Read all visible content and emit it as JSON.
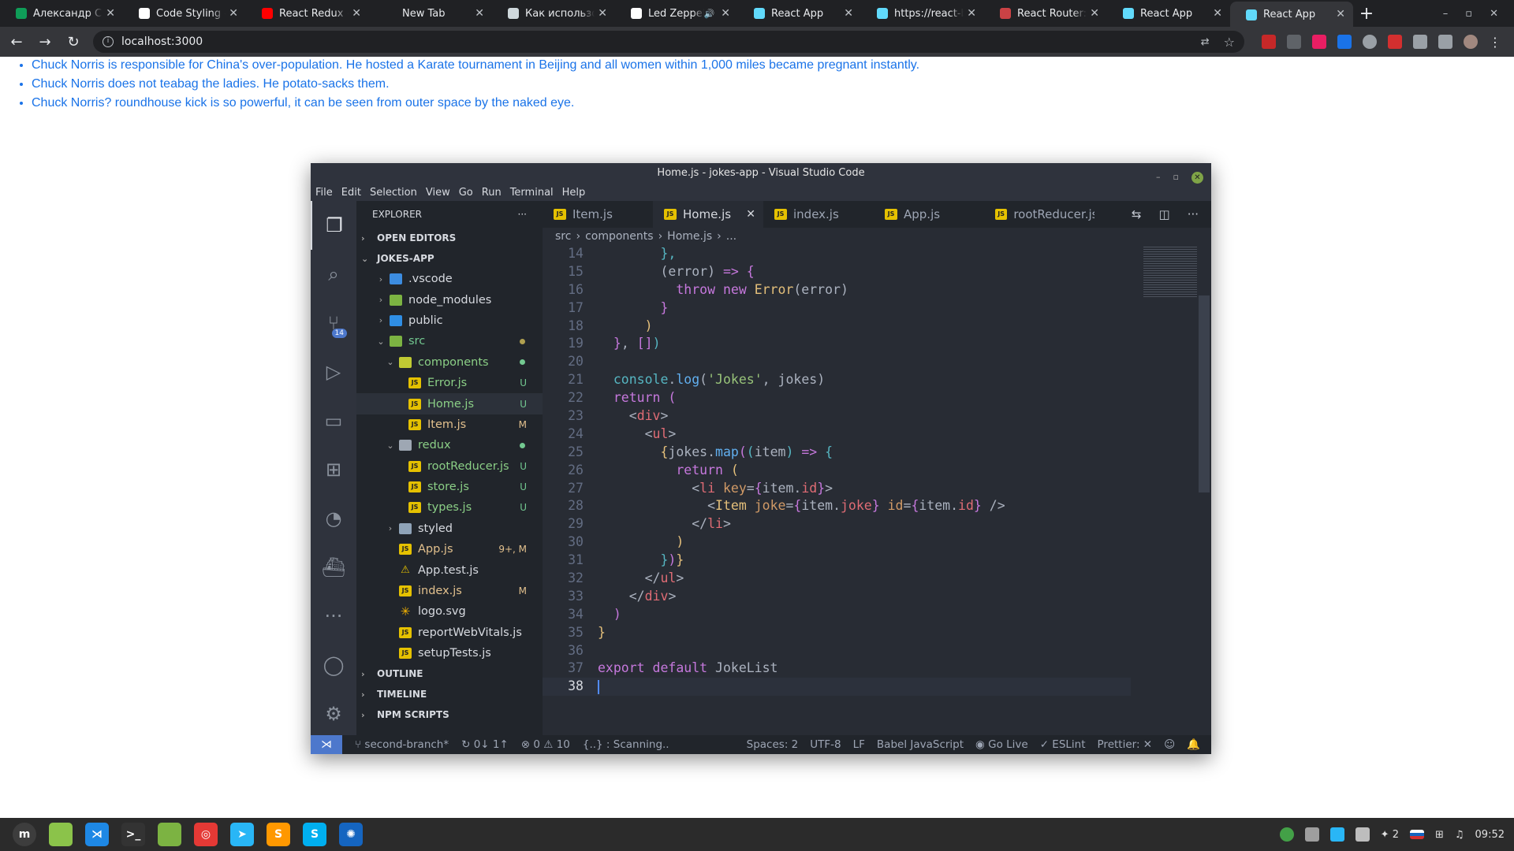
{
  "browser": {
    "tabs": [
      {
        "title": "Александр Cap",
        "color": "#0f9d58",
        "active": false
      },
      {
        "title": "Code Styling - E",
        "color": "#ffffff",
        "active": false
      },
      {
        "title": "React Redux + S",
        "color": "#ff0000",
        "active": false
      },
      {
        "title": "New Tab",
        "color": "",
        "active": false
      },
      {
        "title": "Как использов",
        "color": "#cfd8dc",
        "active": false
      },
      {
        "title": "Led Zeppeli",
        "color": "#ffffff",
        "active": false,
        "audio": "🔊"
      },
      {
        "title": "React App",
        "color": "#61dafb",
        "active": false
      },
      {
        "title": "https://react-b",
        "color": "#61dafb",
        "active": false
      },
      {
        "title": "React Router: D",
        "color": "#ca4245",
        "active": false
      },
      {
        "title": "React App",
        "color": "#61dafb",
        "active": false
      },
      {
        "title": "React App",
        "color": "#61dafb",
        "active": true
      }
    ],
    "url": "localhost:3000"
  },
  "page": {
    "jokes": [
      "Chuck Norris is responsible for China's over-population. He hosted a Karate tournament in Beijing and all women within 1,000 miles became pregnant instantly.",
      "Chuck Norris does not teabag the ladies. He potato-sacks them.",
      "Chuck Norris? roundhouse kick is so powerful, it can be seen from outer space by the naked eye."
    ]
  },
  "vscode": {
    "title": "Home.js - jokes-app - Visual Studio Code",
    "menu": [
      "File",
      "Edit",
      "Selection",
      "View",
      "Go",
      "Run",
      "Terminal",
      "Help"
    ],
    "explorer_title": "EXPLORER",
    "open_editors": "OPEN EDITORS",
    "project": "JOKES-APP",
    "scm_badge": "14",
    "tree": [
      {
        "name": ".vscode",
        "depth": 1,
        "icon": "fi-vscode",
        "chev": "›",
        "label": "lbl-default",
        "status": ""
      },
      {
        "name": "node_modules",
        "depth": 1,
        "icon": "fi-node",
        "chev": "›",
        "label": "lbl-default",
        "status": ""
      },
      {
        "name": "public",
        "depth": 1,
        "icon": "fi-public",
        "chev": "›",
        "label": "lbl-default",
        "status": ""
      },
      {
        "name": "src",
        "depth": 1,
        "icon": "fi-src",
        "chev": "⌄",
        "label": "lbl-src",
        "status": "",
        "dot": "dot"
      },
      {
        "name": "components",
        "depth": 2,
        "icon": "fi-comp",
        "chev": "⌄",
        "label": "lbl-U",
        "status": "",
        "dot": "dot green"
      },
      {
        "name": "Error.js",
        "depth": 3,
        "icon": "fi-js",
        "chev": "",
        "label": "lbl-U",
        "status": "U"
      },
      {
        "name": "Home.js",
        "depth": 3,
        "icon": "fi-js",
        "chev": "",
        "label": "lbl-U",
        "status": "U",
        "selected": true
      },
      {
        "name": "Item.js",
        "depth": 3,
        "icon": "fi-js",
        "chev": "",
        "label": "lbl-M",
        "status": "M"
      },
      {
        "name": "redux",
        "depth": 2,
        "icon": "fi-redux",
        "chev": "⌄",
        "label": "lbl-U",
        "status": "",
        "dot": "dot green"
      },
      {
        "name": "rootReducer.js",
        "depth": 3,
        "icon": "fi-js",
        "chev": "",
        "label": "lbl-U",
        "status": "U"
      },
      {
        "name": "store.js",
        "depth": 3,
        "icon": "fi-js",
        "chev": "",
        "label": "lbl-U",
        "status": "U"
      },
      {
        "name": "types.js",
        "depth": 3,
        "icon": "fi-js",
        "chev": "",
        "label": "lbl-U",
        "status": "U"
      },
      {
        "name": "styled",
        "depth": 2,
        "icon": "fi-folder",
        "chev": "›",
        "label": "lbl-default",
        "status": ""
      },
      {
        "name": "App.js",
        "depth": 2,
        "icon": "fi-js",
        "chev": "",
        "label": "lbl-M",
        "status": "9+, M"
      },
      {
        "name": "App.test.js",
        "depth": 2,
        "icon": "fi-test",
        "chev": "",
        "label": "lbl-default",
        "status": ""
      },
      {
        "name": "index.js",
        "depth": 2,
        "icon": "fi-js",
        "chev": "",
        "label": "lbl-M",
        "status": "M"
      },
      {
        "name": "logo.svg",
        "depth": 2,
        "icon": "fi-svg",
        "chev": "",
        "label": "lbl-default",
        "status": ""
      },
      {
        "name": "reportWebVitals.js",
        "depth": 2,
        "icon": "fi-js",
        "chev": "",
        "label": "lbl-default",
        "status": ""
      },
      {
        "name": "setupTests.js",
        "depth": 2,
        "icon": "fi-js",
        "chev": "",
        "label": "lbl-default",
        "status": ""
      }
    ],
    "bottom_sections": [
      "OUTLINE",
      "TIMELINE",
      "NPM SCRIPTS"
    ],
    "editor_tabs": [
      {
        "name": "Item.js",
        "active": false
      },
      {
        "name": "Home.js",
        "active": true
      },
      {
        "name": "index.js",
        "active": false
      },
      {
        "name": "App.js",
        "active": false
      },
      {
        "name": "rootReducer.js",
        "active": false
      }
    ],
    "breadcrumbs": [
      "src",
      "components",
      "Home.js",
      "..."
    ],
    "code": [
      {
        "n": "14",
        "html": "<span class=\"pl\">        </span><span class=\"b3\">},</span>"
      },
      {
        "n": "15",
        "html": "<span class=\"pl\">        (</span><span class=\"pl\">error</span><span class=\"pl\">) </span><span class=\"kw\">=&gt;</span><span class=\"pl\"> </span><span class=\"b2\">{</span>"
      },
      {
        "n": "16",
        "html": "<span class=\"pl\">          </span><span class=\"kw\">throw new</span><span class=\"pl\"> </span><span class=\"cls\">Error</span><span class=\"pl\">(error)</span>"
      },
      {
        "n": "17",
        "html": "<span class=\"pl\">        </span><span class=\"b2\">}</span>"
      },
      {
        "n": "18",
        "html": "<span class=\"pl\">      </span><span class=\"b1\">)</span>"
      },
      {
        "n": "19",
        "html": "<span class=\"pl\">  </span><span class=\"b2\">}</span><span class=\"pl\">, </span><span class=\"b2\">[]</span><span class=\"b3\">)</span>"
      },
      {
        "n": "20",
        "html": ""
      },
      {
        "n": "21",
        "html": "<span class=\"pl\">  </span><span class=\"cy\">console</span><span class=\"pl\">.</span><span class=\"fn\">log</span><span class=\"pl\">(</span><span class=\"st\">'Jokes'</span><span class=\"pl\">, jokes)</span>"
      },
      {
        "n": "22",
        "html": "<span class=\"pl\">  </span><span class=\"kw\">return</span><span class=\"pl\"> </span><span class=\"b2\">(</span>"
      },
      {
        "n": "23",
        "html": "<span class=\"pl\">    </span><span class=\"pl\">&lt;</span><span class=\"tg\">div</span><span class=\"pl\">&gt;</span>"
      },
      {
        "n": "24",
        "html": "<span class=\"pl\">      </span><span class=\"pl\">&lt;</span><span class=\"tg\">ul</span><span class=\"pl\">&gt;</span>"
      },
      {
        "n": "25",
        "html": "<span class=\"pl\">        </span><span class=\"b1\">{</span><span class=\"pl\">jokes.</span><span class=\"fn\">map</span><span class=\"b2\">(</span><span class=\"b3\">(</span><span class=\"pl\">item</span><span class=\"b3\">)</span><span class=\"pl\"> </span><span class=\"kw\">=&gt;</span><span class=\"pl\"> </span><span class=\"b3\">{</span>"
      },
      {
        "n": "26",
        "html": "<span class=\"pl\">          </span><span class=\"kw\">return</span><span class=\"pl\"> </span><span class=\"b1\">(</span>"
      },
      {
        "n": "27",
        "html": "<span class=\"pl\">            </span><span class=\"pl\">&lt;</span><span class=\"tg\">li</span><span class=\"pl\"> </span><span class=\"at\">key</span><span class=\"pl\">=</span><span class=\"b2\">{</span><span class=\"pl\">item.</span><span class=\"tg\">id</span><span class=\"b2\">}</span><span class=\"pl\">&gt;</span>"
      },
      {
        "n": "28",
        "html": "<span class=\"pl\">              </span><span class=\"pl\">&lt;</span><span class=\"cls\">Item</span><span class=\"pl\"> </span><span class=\"at\">joke</span><span class=\"pl\">=</span><span class=\"b2\">{</span><span class=\"pl\">item.</span><span class=\"tg\">joke</span><span class=\"b2\">}</span><span class=\"pl\"> </span><span class=\"at\">id</span><span class=\"pl\">=</span><span class=\"b2\">{</span><span class=\"pl\">item.</span><span class=\"tg\">id</span><span class=\"b2\">}</span><span class=\"pl\"> /&gt;</span>"
      },
      {
        "n": "29",
        "html": "<span class=\"pl\">            </span><span class=\"pl\">&lt;/</span><span class=\"tg\">li</span><span class=\"pl\">&gt;</span>"
      },
      {
        "n": "30",
        "html": "<span class=\"pl\">          </span><span class=\"b1\">)</span>"
      },
      {
        "n": "31",
        "html": "<span class=\"pl\">        </span><span class=\"b3\">}</span><span class=\"b2\">)</span><span class=\"b1\">}</span>"
      },
      {
        "n": "32",
        "html": "<span class=\"pl\">      </span><span class=\"pl\">&lt;/</span><span class=\"tg\">ul</span><span class=\"pl\">&gt;</span>"
      },
      {
        "n": "33",
        "html": "<span class=\"pl\">    </span><span class=\"pl\">&lt;/</span><span class=\"tg\">div</span><span class=\"pl\">&gt;</span>"
      },
      {
        "n": "34",
        "html": "<span class=\"pl\">  </span><span class=\"b2\">)</span>"
      },
      {
        "n": "35",
        "html": "<span class=\"b1\">}</span>"
      },
      {
        "n": "36",
        "html": ""
      },
      {
        "n": "37",
        "html": "<span class=\"kw\">export default</span><span class=\"pl\"> JokeList</span>"
      },
      {
        "n": "38",
        "html": "",
        "current": true
      }
    ],
    "status": {
      "branch": "second-branch*",
      "sync": "0↓ 1↑",
      "problems": "⊗ 0 ⚠ 10",
      "scanning": "{..} : Scanning..",
      "spaces": "Spaces: 2",
      "encoding": "UTF-8",
      "eol": "LF",
      "language": "Babel JavaScript",
      "golive": "Go Live",
      "eslint": "✓ ESLint",
      "prettier": "Prettier: ✕"
    }
  },
  "taskbar": {
    "apps": [
      {
        "name": "mint-menu",
        "color": "#3d3d3d",
        "glyph": "m"
      },
      {
        "name": "files-desktop",
        "color": "#8bc34a",
        "glyph": ""
      },
      {
        "name": "vscode",
        "color": "#1e88e5",
        "glyph": "⋊"
      },
      {
        "name": "terminal",
        "color": "#333333",
        "glyph": ">_"
      },
      {
        "name": "file-manager",
        "color": "#7cb342",
        "glyph": ""
      },
      {
        "name": "chrome",
        "color": "#e53935",
        "glyph": "◎"
      },
      {
        "name": "telegram",
        "color": "#29b6f6",
        "glyph": "➤"
      },
      {
        "name": "sublime",
        "color": "#ff9800",
        "glyph": "S"
      },
      {
        "name": "skype",
        "color": "#00aff0",
        "glyph": "S"
      },
      {
        "name": "network-app",
        "color": "#1565c0",
        "glyph": "✺"
      }
    ],
    "tray": {
      "notif_count": "2",
      "time": "09:52"
    }
  }
}
